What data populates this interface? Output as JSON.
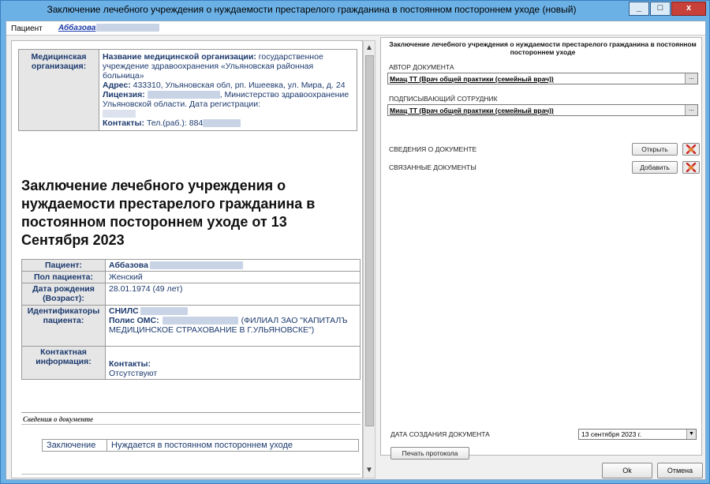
{
  "window": {
    "title": "Заключение лечебного учреждения о нуждаемости престарелого гражданина в постоянном постороннем уходе (новый)",
    "min_label": "_",
    "max_label": "□",
    "close_label": "x"
  },
  "patient_bar": {
    "label": "Пациент",
    "name": "Аббазова"
  },
  "document": {
    "org_table": {
      "header": "Медицинская организация:",
      "name_label": "Название медицинской организации:",
      "name_value": "государственное учреждение здравоохранения «Ульяновская районная больница»",
      "address_label": "Адрес:",
      "address_value": "433310, Ульяновская обл, рп. Ишеевка, ул. Мира, д. 24",
      "license_label": "Лицензия:",
      "license_value": ", Министерство здравоохранение Ульяновской области. Дата регистрации:",
      "contacts_label": "Контакты:",
      "contacts_value": "Тел.(раб.): 884"
    },
    "title": "Заключение лечебного учреждения о нуждаемости престарелого гражданина в постоянном постороннем уходе от 13 Сентября 2023",
    "patient_table": {
      "patient_label": "Пациент:",
      "patient_value": "Аббазова",
      "sex_label": "Пол пациента:",
      "sex_value": "Женский",
      "dob_label": "Дата рождения (Возраст):",
      "dob_value": "28.01.1974 (49 лет)",
      "ids_label": "Идентификаторы пациента:",
      "snils_label": "СНИЛС",
      "oms_label": "Полис ОМС:",
      "oms_value": "(ФИЛИАЛ ЗАО \"КАПИТАЛЪ МЕДИЦИНСКОЕ СТРАХОВАНИЕ В Г.УЛЬЯНОВСКЕ\")",
      "contact_label": "Контактная информация:",
      "contacts_label": "Контакты:",
      "contacts_value": "Отсутствуют"
    },
    "section_title": "Сведения о документе",
    "conclusion_label": "Заключение",
    "conclusion_value": "Нуждается в постоянном постороннем уходе"
  },
  "right_panel": {
    "title": "Заключение лечебного учреждения о нуждаемости престарелого гражданина в постоянном постороннем уходе",
    "author_label": "АВТОР ДОКУМЕНТА",
    "author_value": "Миац ТТ (Врач общей практики (семейный врач))",
    "signer_label": "ПОДПИСЫВАЮЩИЙ СОТРУДНИК",
    "signer_value": "Миац ТТ (Врач общей практики (семейный врач))",
    "dots_label": "...",
    "doc_info_label": "СВЕДЕНИЯ О ДОКУМЕНТЕ",
    "open_button": "Открыть",
    "related_label": "СВЯЗАННЫЕ ДОКУМЕНТЫ",
    "add_button": "Добавить",
    "date_label": "ДАТА СОЗДАНИЯ ДОКУМЕНТА",
    "date_value": "13 сентября 2023 г.",
    "print_button": "Печать протокола"
  },
  "footer": {
    "ok_button": "Ok",
    "cancel_button": "Отмена"
  },
  "colors": {
    "title_bar": "#6cb1e6",
    "label_blue": "#1c3a6e",
    "close_red": "#c7403a"
  }
}
